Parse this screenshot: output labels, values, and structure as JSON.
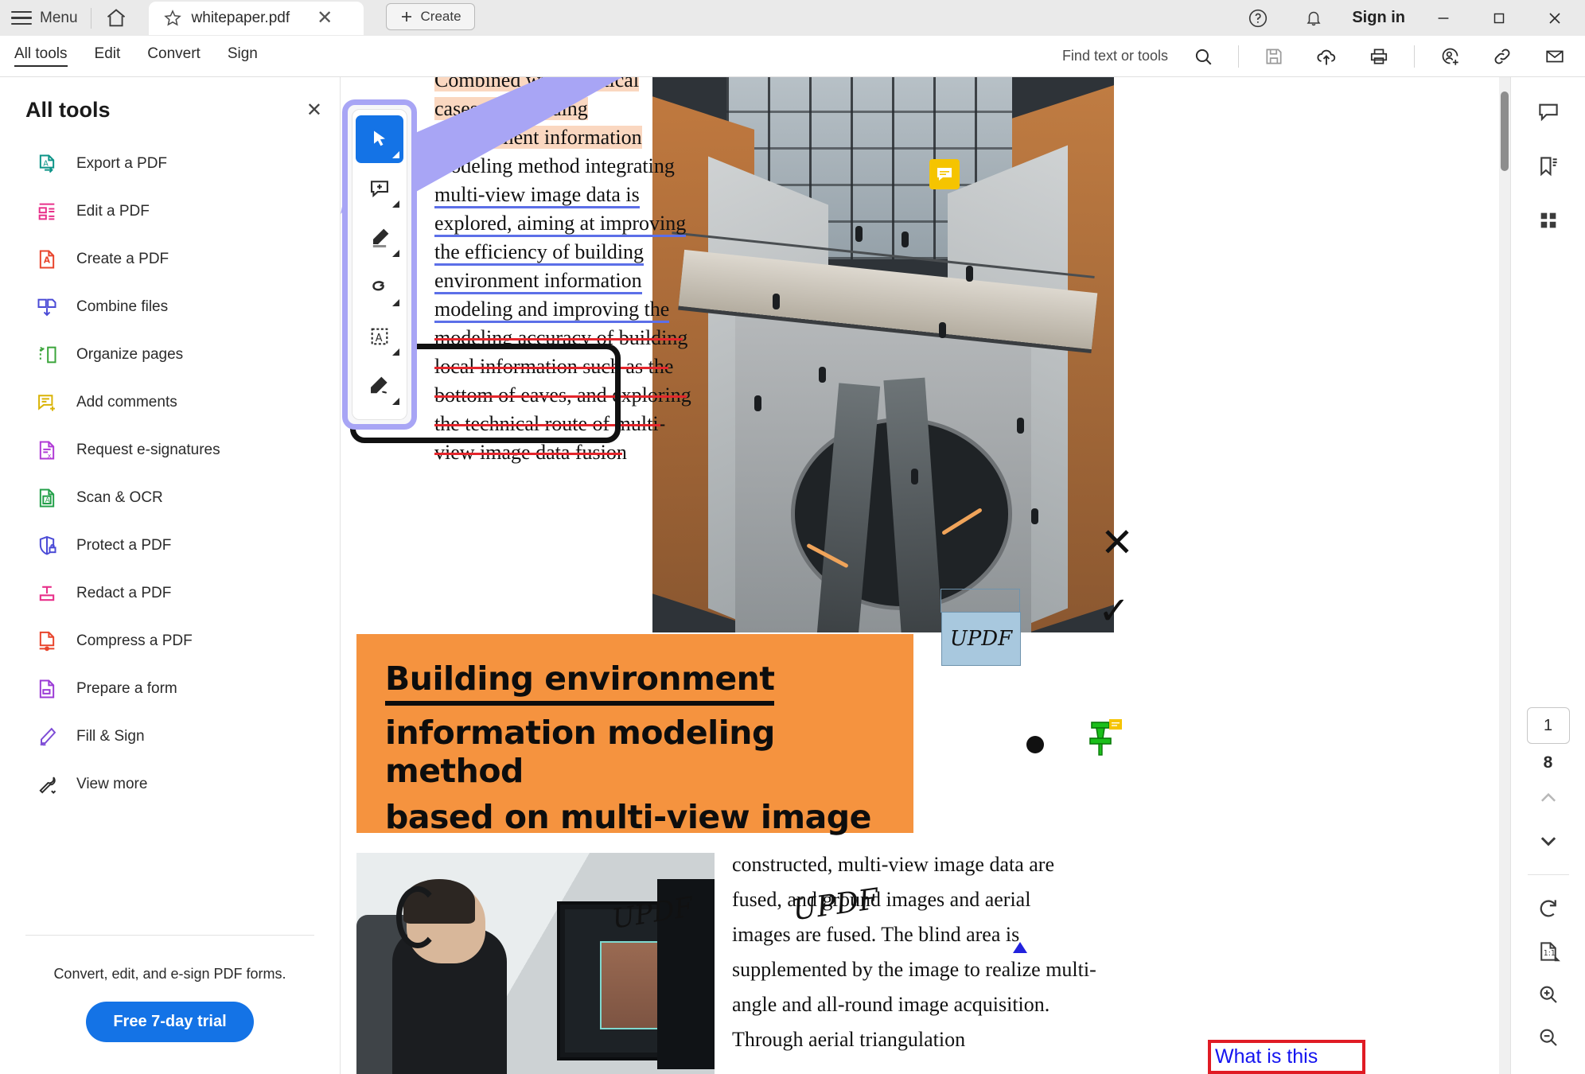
{
  "titlebar": {
    "menu_label": "Menu",
    "home_icon": "home-icon",
    "tab": {
      "star_icon": "star-icon",
      "name": "whitepaper.pdf",
      "close_icon": "close-icon"
    },
    "create_label": "Create",
    "help_icon": "help-circle-icon",
    "bell_icon": "bell-icon",
    "sign_in_label": "Sign in",
    "minimize_icon": "minimize-icon",
    "maximize_icon": "maximize-icon",
    "close_icon": "window-close-icon"
  },
  "menubar": {
    "tabs": [
      {
        "label": "All tools",
        "active": true
      },
      {
        "label": "Edit",
        "active": false
      },
      {
        "label": "Convert",
        "active": false
      },
      {
        "label": "Sign",
        "active": false
      }
    ],
    "find_label": "Find text or tools",
    "search_icon": "search-icon",
    "actions": [
      {
        "icon": "save-icon",
        "name": "save-button"
      },
      {
        "icon": "cloud-upload-icon",
        "name": "upload-button"
      },
      {
        "icon": "print-icon",
        "name": "print-button"
      },
      {
        "icon": "add-person-icon",
        "name": "share-people-button"
      },
      {
        "icon": "link-icon",
        "name": "copy-link-button"
      },
      {
        "icon": "mail-icon",
        "name": "email-button"
      }
    ]
  },
  "sidebar": {
    "title": "All tools",
    "close_icon": "close-icon",
    "items": [
      {
        "label": "Export a PDF",
        "icon": "export-pdf-icon",
        "color": "#0d9488"
      },
      {
        "label": "Edit a PDF",
        "icon": "edit-pdf-icon",
        "color": "#e8308a"
      },
      {
        "label": "Create a PDF",
        "icon": "create-pdf-icon",
        "color": "#e8442c"
      },
      {
        "label": "Combine files",
        "icon": "combine-files-icon",
        "color": "#4b4bd6"
      },
      {
        "label": "Organize pages",
        "icon": "organize-pages-icon",
        "color": "#3ba53b"
      },
      {
        "label": "Add comments",
        "icon": "add-comments-icon",
        "color": "#d9b306"
      },
      {
        "label": "Request e-signatures",
        "icon": "request-esign-icon",
        "color": "#b03ad6"
      },
      {
        "label": "Scan & OCR",
        "icon": "scan-ocr-icon",
        "color": "#23a049"
      },
      {
        "label": "Protect a PDF",
        "icon": "protect-pdf-icon",
        "color": "#4b4bd6"
      },
      {
        "label": "Redact a PDF",
        "icon": "redact-pdf-icon",
        "color": "#e8308a"
      },
      {
        "label": "Compress a PDF",
        "icon": "compress-pdf-icon",
        "color": "#e8442c"
      },
      {
        "label": "Prepare a form",
        "icon": "prepare-form-icon",
        "color": "#9b3ad6"
      },
      {
        "label": "Fill & Sign",
        "icon": "fill-sign-icon",
        "color": "#7d4bd6"
      },
      {
        "label": "View more",
        "icon": "wrench-icon",
        "color": "#2b2b2b"
      }
    ],
    "promo_text": "Convert, edit, and e-sign PDF forms.",
    "trial_button": "Free 7-day trial",
    "trial_color": "#1473e6"
  },
  "float_toolbar": {
    "border_color": "#a8a5f5",
    "tools": [
      {
        "name": "select-tool",
        "icon": "cursor-arrow-icon",
        "active": true
      },
      {
        "name": "add-comment-tool",
        "icon": "comment-plus-icon",
        "active": false
      },
      {
        "name": "highlight-tool",
        "icon": "highlighter-icon",
        "active": false
      },
      {
        "name": "draw-tool",
        "icon": "freehand-loop-icon",
        "active": false
      },
      {
        "name": "text-box-tool",
        "icon": "text-box-icon",
        "active": false
      },
      {
        "name": "signature-tool",
        "icon": "signature-pen-icon",
        "active": false
      }
    ]
  },
  "document": {
    "text_lines": [
      {
        "text": "Combined with practical",
        "style": "highlight-clipped"
      },
      {
        "text": "cases, the building",
        "style": "highlight"
      },
      {
        "text": "environment information",
        "style": "highlight"
      },
      {
        "text": "modeling method integrating",
        "style": "plain"
      },
      {
        "text": "multi-view image data is",
        "style": "underline"
      },
      {
        "text": "explored, aiming at improving",
        "style": "underline"
      },
      {
        "text": "the efficiency of building",
        "style": "underline"
      },
      {
        "text": "environment information",
        "style": "underline"
      },
      {
        "text": "modeling and improving the",
        "style": "underline"
      },
      {
        "text": "modeling accuracy of building",
        "style": "strikethrough"
      },
      {
        "text": "local information such as the",
        "style": "strikethrough"
      },
      {
        "text": "bottom of eaves, and exploring",
        "style": "strikethrough"
      },
      {
        "text": "the technical route of multi-",
        "style": "strikethrough"
      },
      {
        "text": "view image data fusion",
        "style": "strikethrough"
      }
    ],
    "bottom_text_lines": [
      "constructed, multi-view image data are",
      "fused, and ground images and aerial",
      "images are fused. The blind area is",
      "supplemented by the image to realize multi-",
      "angle and all-round image acquisition.",
      "Through aerial triangulation"
    ],
    "orange_title": {
      "line1": "Building environment",
      "line2": "information modeling method",
      "line3": "based on multi-view image",
      "bg_color": "#f5933f"
    },
    "annotations": {
      "note_icon": "sticky-note-icon",
      "arrow_color": "#a8a5f5",
      "black_box": "freehand-rectangle",
      "x_mark": "✕",
      "check_mark": "✓",
      "updf_stamp_text": "UPDF",
      "updf_stamp_color": "#a8c8de",
      "updf_ink_text": "UPDF",
      "dot": "black-dot",
      "pin_icon": "green-pushpin-icon",
      "callout_text": "What is this",
      "callout_border": "#e01b24",
      "callout_text_color": "#1414f0",
      "highlight_color": "#fad7c0",
      "underline_color": "#5c6fe8",
      "strikethrough_color": "#e4262c"
    },
    "photo2_watermark": "UPDF"
  },
  "rail": {
    "top_icons": [
      {
        "name": "comments-panel-button",
        "icon": "comment-icon"
      },
      {
        "name": "bookmarks-panel-button",
        "icon": "bookmark-icon"
      },
      {
        "name": "thumbnails-panel-button",
        "icon": "grid-icon"
      }
    ],
    "current_page": "1",
    "total_pages": "8",
    "prev_icon": "chevron-up-icon",
    "next_icon": "chevron-down-icon",
    "bottom_icons": [
      {
        "name": "rotate-button",
        "icon": "rotate-cw-icon"
      },
      {
        "name": "fit-page-button",
        "icon": "one-to-one-icon"
      },
      {
        "name": "zoom-in-button",
        "icon": "zoom-in-icon"
      },
      {
        "name": "zoom-out-button",
        "icon": "zoom-out-icon"
      }
    ]
  }
}
